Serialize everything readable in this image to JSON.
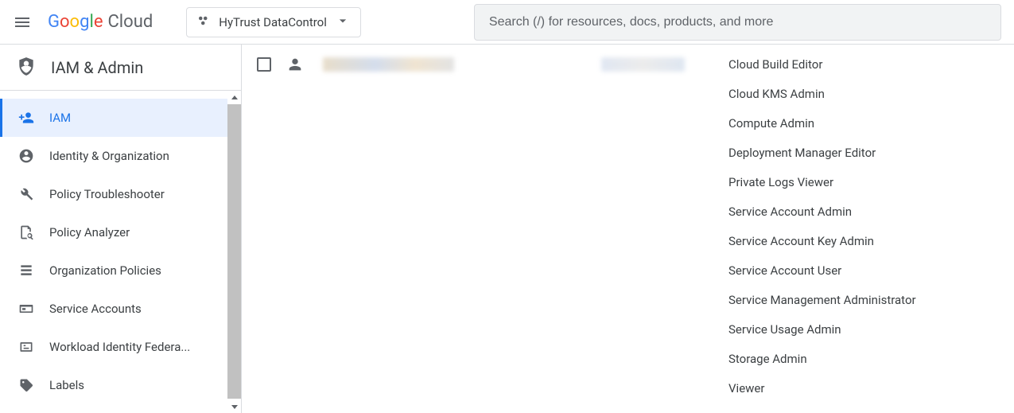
{
  "header": {
    "project_name": "HyTrust DataControl",
    "search_placeholder": "Search (/) for resources, docs, products, and more",
    "cloud_word": "Cloud"
  },
  "sidebar": {
    "title": "IAM & Admin",
    "items": [
      {
        "label": "IAM",
        "icon": "person-add-icon",
        "active": true
      },
      {
        "label": "Identity & Organization",
        "icon": "account-circle-icon",
        "active": false
      },
      {
        "label": "Policy Troubleshooter",
        "icon": "wrench-icon",
        "active": false
      },
      {
        "label": "Policy Analyzer",
        "icon": "doc-search-icon",
        "active": false
      },
      {
        "label": "Organization Policies",
        "icon": "list-icon",
        "active": false
      },
      {
        "label": "Service Accounts",
        "icon": "card-icon",
        "active": false
      },
      {
        "label": "Workload Identity Federa...",
        "icon": "badge-icon",
        "active": false
      },
      {
        "label": "Labels",
        "icon": "tag-icon",
        "active": false
      }
    ]
  },
  "main": {
    "row": {
      "principal_redacted": true,
      "name_redacted": true,
      "roles": [
        "Cloud Build Editor",
        "Cloud KMS Admin",
        "Compute Admin",
        "Deployment Manager Editor",
        "Private Logs Viewer",
        "Service Account Admin",
        "Service Account Key Admin",
        "Service Account User",
        "Service Management Administrator",
        "Service Usage Admin",
        "Storage Admin",
        "Viewer"
      ]
    }
  }
}
